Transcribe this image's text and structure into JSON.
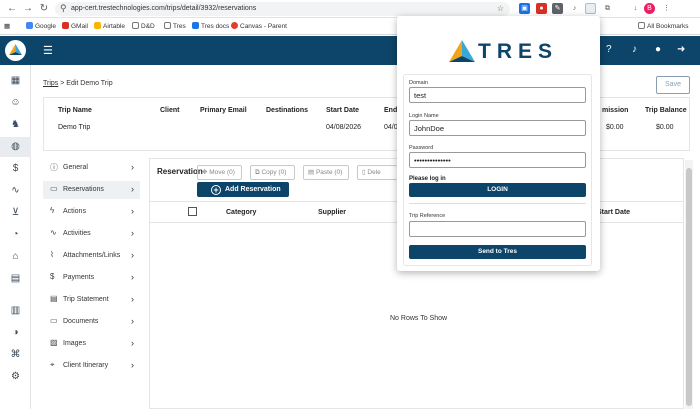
{
  "browser": {
    "url": "app-cert.trestechnologies.com/trips/detail/3932/reservations",
    "back_icon": "arrow-left-icon",
    "bookmarks": [
      {
        "label": "Google",
        "color": "#4285f4"
      },
      {
        "label": "GMail",
        "color": "#d93025"
      },
      {
        "label": "Airtable",
        "color": "#fcb400"
      },
      {
        "label": "D&D",
        "color": "#777777"
      },
      {
        "label": "Tres",
        "color": "#777777"
      },
      {
        "label": "Tres docs",
        "color": "#1a73e8"
      },
      {
        "label": "Canvas - Parent",
        "color": "#e03c31"
      }
    ],
    "all_bookmarks": "All Bookmarks",
    "profile_initial": "B"
  },
  "app": {
    "brand_color": "#0d4469"
  },
  "breadcrumb": {
    "parent": "Trips",
    "separator": ">",
    "current": "Edit Demo Trip"
  },
  "save_label": "Save",
  "summary": {
    "headers": [
      "Trip Name",
      "Client",
      "Primary Email",
      "Destinations",
      "Start Date",
      "End",
      "mission",
      "Trip Balance"
    ],
    "values": {
      "trip_name": "Demo Trip",
      "start_date": "04/08/2026",
      "end_date": "04/0",
      "commission": "$0.00",
      "trip_balance": "$0.00"
    }
  },
  "left_nav": [
    {
      "label": "General",
      "icon": "info-icon",
      "active": false
    },
    {
      "label": "Reservations",
      "icon": "folder-icon",
      "active": true
    },
    {
      "label": "Actions",
      "icon": "lightning-icon",
      "active": false
    },
    {
      "label": "Activities",
      "icon": "pulse-icon",
      "active": false
    },
    {
      "label": "Attachments/Links",
      "icon": "paperclip-icon",
      "active": false
    },
    {
      "label": "Payments",
      "icon": "dollar-icon",
      "active": false
    },
    {
      "label": "Trip Statement",
      "icon": "document-icon",
      "active": false
    },
    {
      "label": "Documents",
      "icon": "folder-icon",
      "active": false
    },
    {
      "label": "Images",
      "icon": "image-icon",
      "active": false
    },
    {
      "label": "Client Itinerary",
      "icon": "map-pin-icon",
      "active": false
    }
  ],
  "reservations": {
    "title": "Reservation",
    "toolbar": {
      "move": "Move (0)",
      "copy": "Copy (0)",
      "paste": "Paste (0)",
      "delete": "Dele"
    },
    "add_button": "Add Reservation",
    "columns": [
      "Category",
      "Supplier",
      "Start Date"
    ],
    "empty_text": "No Rows To Show"
  },
  "popup": {
    "logo_text": "TRES",
    "domain_label": "Domain",
    "domain_value": "test",
    "login_label": "Login Name",
    "login_value": "JohnDoe",
    "password_label": "Password",
    "password_value": "••••••••••••••",
    "please_login": "Please log in",
    "login_button": "LOGIN",
    "trip_ref_label": "Trip Reference",
    "trip_ref_value": "",
    "send_button": "Send to Tres"
  }
}
